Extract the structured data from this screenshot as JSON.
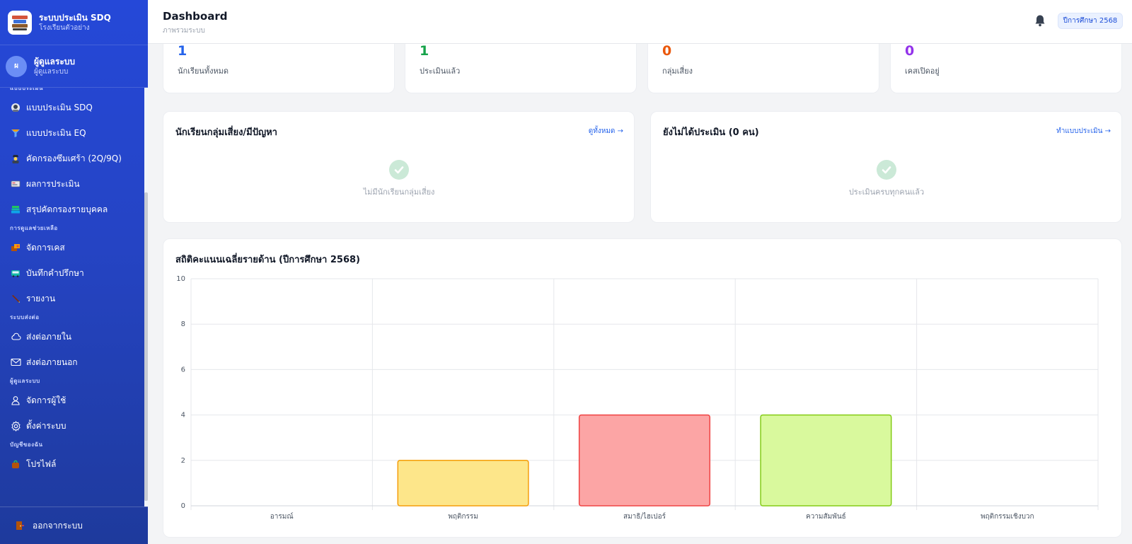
{
  "app": {
    "title": "ระบบประเมิน SDQ",
    "subtitle": "โรงเรียนตัวอย่าง"
  },
  "user": {
    "initial": "ผ",
    "name": "ผู้ดูแลระบบ",
    "role": "ผู้ดูแลระบบ"
  },
  "sidebar": {
    "sections": [
      {
        "label": "แบบประเมิน",
        "items": [
          {
            "label": "แบบประเมิน SDQ",
            "icon": "child-face-icon"
          },
          {
            "label": "แบบประเมิน EQ",
            "icon": "funnel-icon"
          },
          {
            "label": "คัดกรองซึมเศร้า (2Q/9Q)",
            "icon": "detective-icon"
          },
          {
            "label": "ผลการประเมิน",
            "icon": "report-card-icon"
          },
          {
            "label": "สรุปคัดกรองรายบุคคล",
            "icon": "stacked-books-icon"
          }
        ]
      },
      {
        "label": "การดูแลช่วยเหลือ",
        "items": [
          {
            "label": "จัดการเคส",
            "icon": "case-box-icon"
          },
          {
            "label": "บันทึกคำปรึกษา",
            "icon": "bus-icon"
          },
          {
            "label": "รายงาน",
            "icon": "pen-icon"
          }
        ]
      },
      {
        "label": "ระบบส่งต่อ",
        "items": [
          {
            "label": "ส่งต่อภายใน",
            "icon": "cloud-icon"
          },
          {
            "label": "ส่งต่อภายนอก",
            "icon": "envelope-icon"
          }
        ]
      },
      {
        "label": "ผู้ดูแลระบบ",
        "items": [
          {
            "label": "จัดการผู้ใช้",
            "icon": "user-icon"
          },
          {
            "label": "ตั้งค่าระบบ",
            "icon": "gear-icon"
          }
        ]
      },
      {
        "label": "บัญชีของฉัน",
        "items": [
          {
            "label": "โปรไฟล์",
            "icon": "profile-bag-icon"
          }
        ]
      }
    ],
    "logout_label": "ออกจากระบบ"
  },
  "header": {
    "title": "Dashboard",
    "subtitle": "ภาพรวมระบบ",
    "year_badge": "ปีการศึกษา 2568"
  },
  "stats": [
    {
      "value": "1",
      "label": "นักเรียนทั้งหมด",
      "color": "#2563eb"
    },
    {
      "value": "1",
      "label": "ประเมินแล้ว",
      "color": "#16a34a"
    },
    {
      "value": "0",
      "label": "กลุ่มเสี่ยง",
      "color": "#ea580c"
    },
    {
      "value": "0",
      "label": "เคสเปิดอยู่",
      "color": "#9333ea"
    }
  ],
  "risk_panel": {
    "title": "นักเรียนกลุ่มเสี่ยง/มีปัญหา",
    "link": "ดูทั้งหมด →",
    "empty": "ไม่มีนักเรียนกลุ่มเสี่ยง"
  },
  "pending_panel": {
    "title": "ยังไม่ได้ประเมิน (0 คน)",
    "link": "ทำแบบประเมิน →",
    "empty": "ประเมินครบทุกคนแล้ว"
  },
  "chart_panel": {
    "title": "สถิติคะแนนเฉลี่ยรายด้าน (ปีการศึกษา 2568)"
  },
  "chart_data": {
    "type": "bar",
    "categories": [
      "อารมณ์",
      "พฤติกรรม",
      "สมาธิ/ไฮเปอร์",
      "ความสัมพันธ์",
      "พฤติกรรมเชิงบวก"
    ],
    "values": [
      0,
      2,
      4,
      4,
      0
    ],
    "ylim": [
      0,
      10
    ],
    "yticks": [
      0,
      2,
      4,
      6,
      8,
      10
    ],
    "grid": true,
    "bar_fill": [
      "#fca5a5",
      "#fde68a",
      "#fca5a5",
      "#d9f99d",
      "#bfdbfe"
    ],
    "bar_stroke": [
      "#ef4444",
      "#f59e0b",
      "#ef4444",
      "#84cc16",
      "#3b82f6"
    ]
  }
}
